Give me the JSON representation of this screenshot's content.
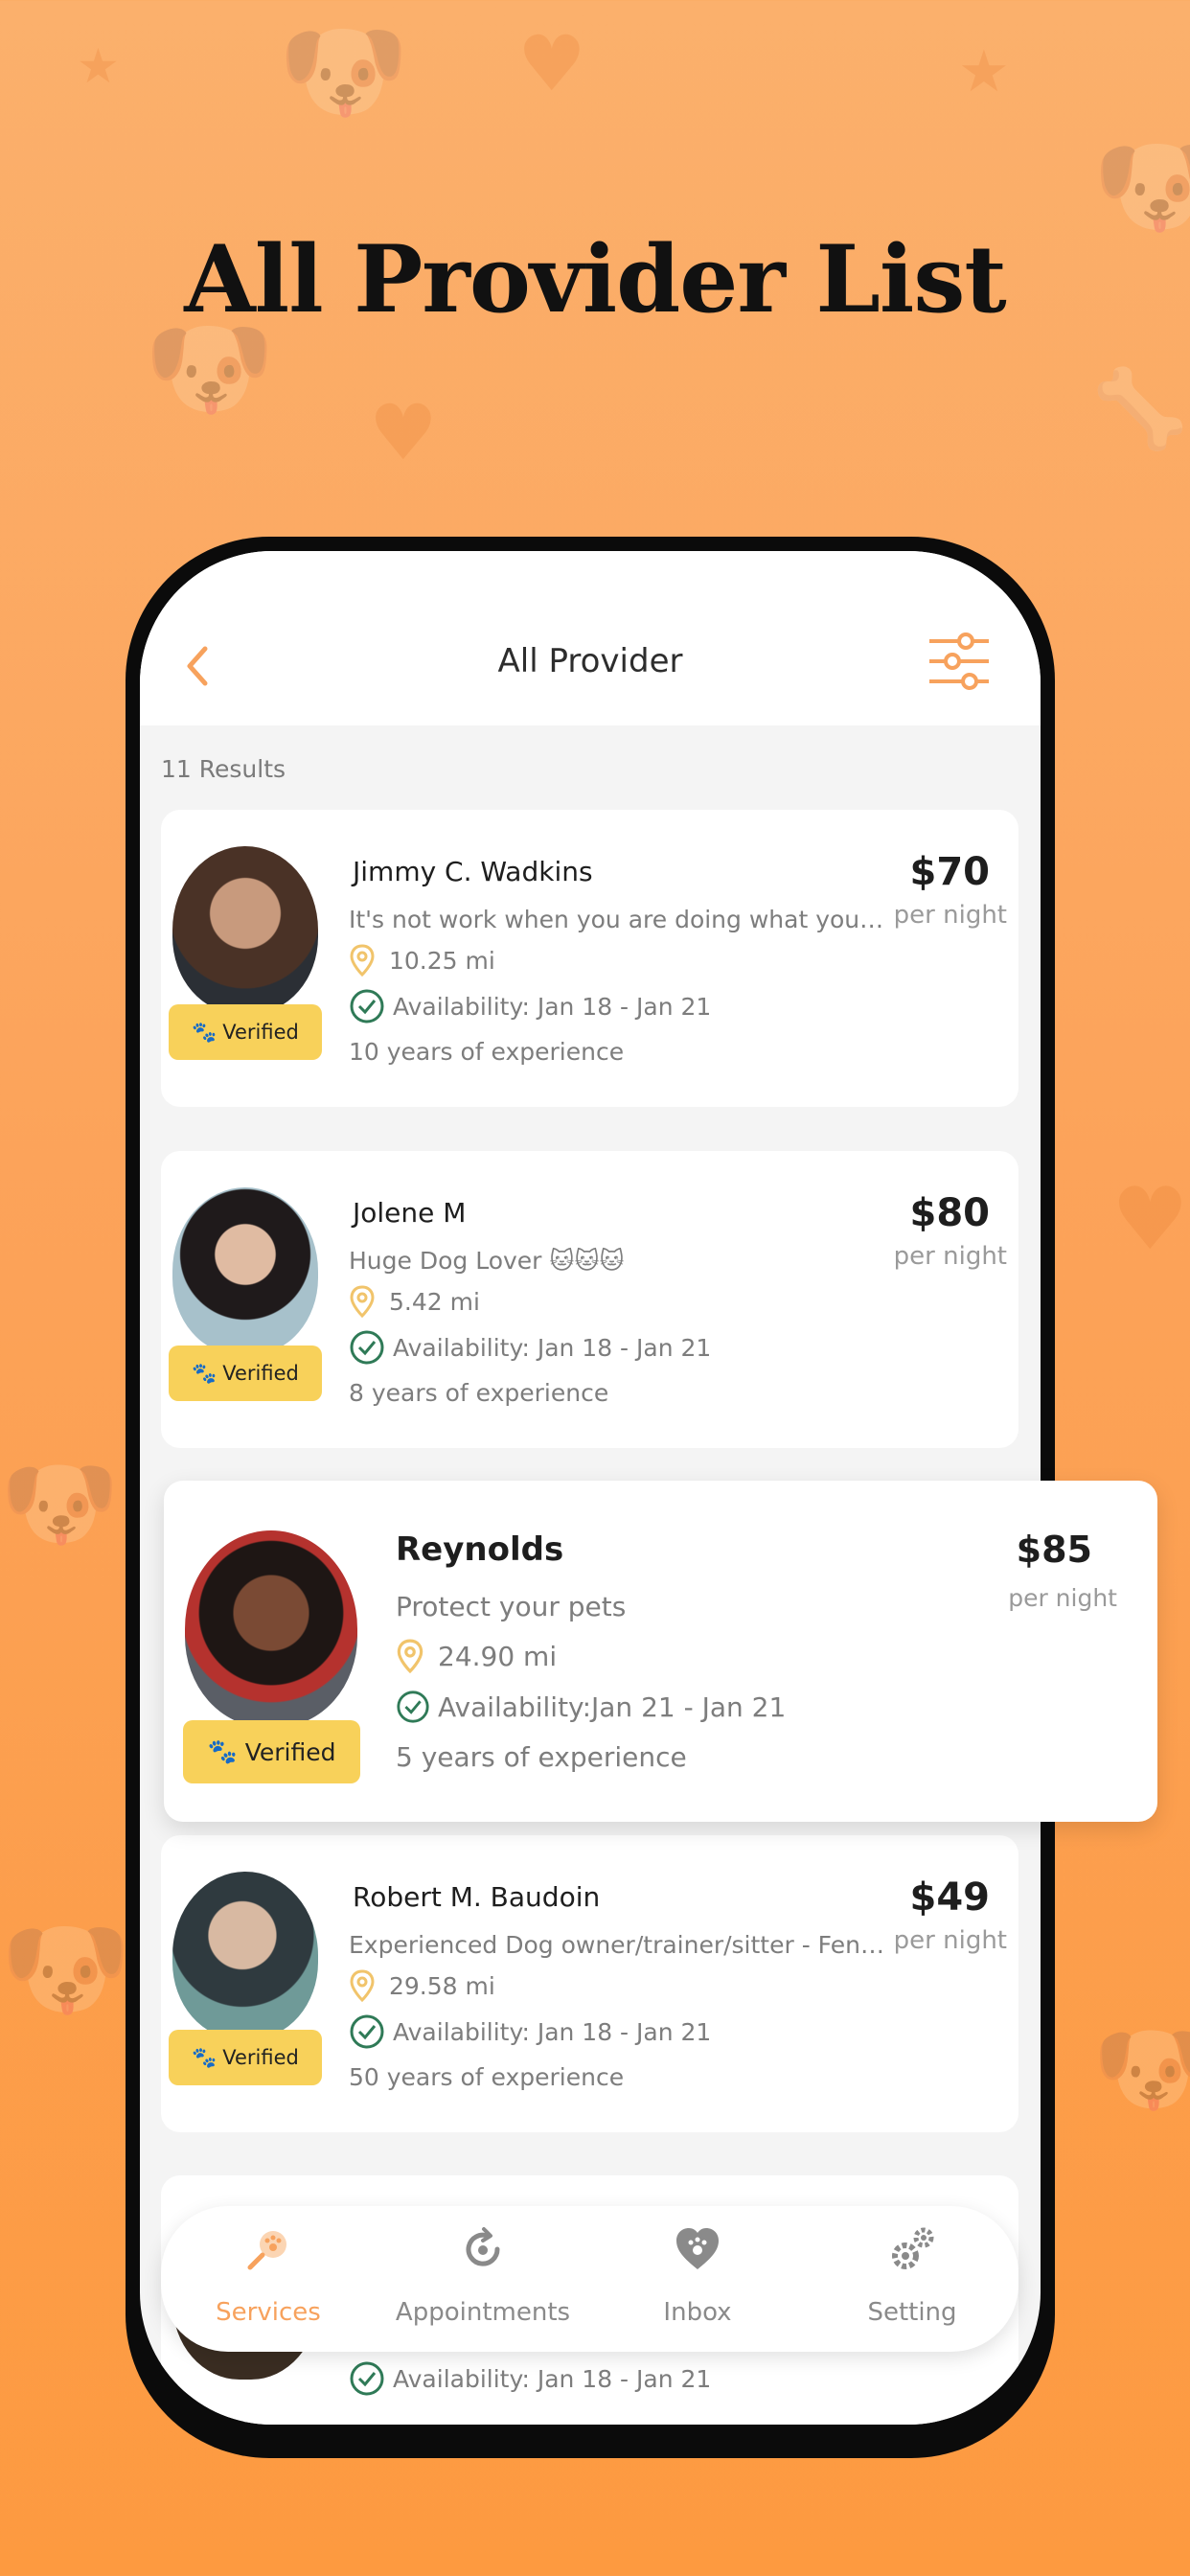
{
  "headline": "All Provider List",
  "nav": {
    "title": "All Provider"
  },
  "results_label": "11 Results",
  "providers": [
    {
      "name": "Jimmy C. Wadkins",
      "description": "It's not work when you are doing what you l...",
      "distance": "10.25 mi",
      "availability": "Availability: Jan 18 - Jan 21",
      "experience": "10 years of experience",
      "price": "$70",
      "per": "per night",
      "badge": "Verified"
    },
    {
      "name": "Jolene M",
      "description": "Huge Dog Lover 🐱🐱🐱",
      "distance": "5.42 mi",
      "availability": "Availability: Jan 18 - Jan 21",
      "experience": "8 years of experience",
      "price": "$80",
      "per": "per night",
      "badge": "Verified"
    },
    {
      "name": "Reynolds",
      "description": "Protect your pets",
      "distance": "24.90 mi",
      "availability": "Availability:Jan 21 - Jan 21",
      "experience": "5 years of experience",
      "price": "$85",
      "per": "per night",
      "badge": "Verified"
    },
    {
      "name": "Robert M. Baudoin",
      "description": "Experienced Dog owner/trainer/sitter - Fenc...",
      "distance": "29.58 mi",
      "availability": "Availability: Jan 18 - Jan 21",
      "experience": "50 years of experience",
      "price": "$49",
      "per": "per night",
      "badge": "Verified"
    },
    {
      "availability": "Availability: Jan 18 - Jan 21"
    }
  ],
  "tabs": [
    {
      "label": "Services",
      "icon": "paw-search-icon",
      "active": true
    },
    {
      "label": "Appointments",
      "icon": "calendar-refresh-icon",
      "active": false
    },
    {
      "label": "Inbox",
      "icon": "heart-paw-icon",
      "active": false
    },
    {
      "label": "Setting",
      "icon": "gears-icon",
      "active": false
    }
  ],
  "colors": {
    "accent": "#f7a25d",
    "background_orange": "#fca35a",
    "badge_yellow": "#f8d15a",
    "check_green": "#2f7a57",
    "pin_yellow": "#f1c46b"
  }
}
